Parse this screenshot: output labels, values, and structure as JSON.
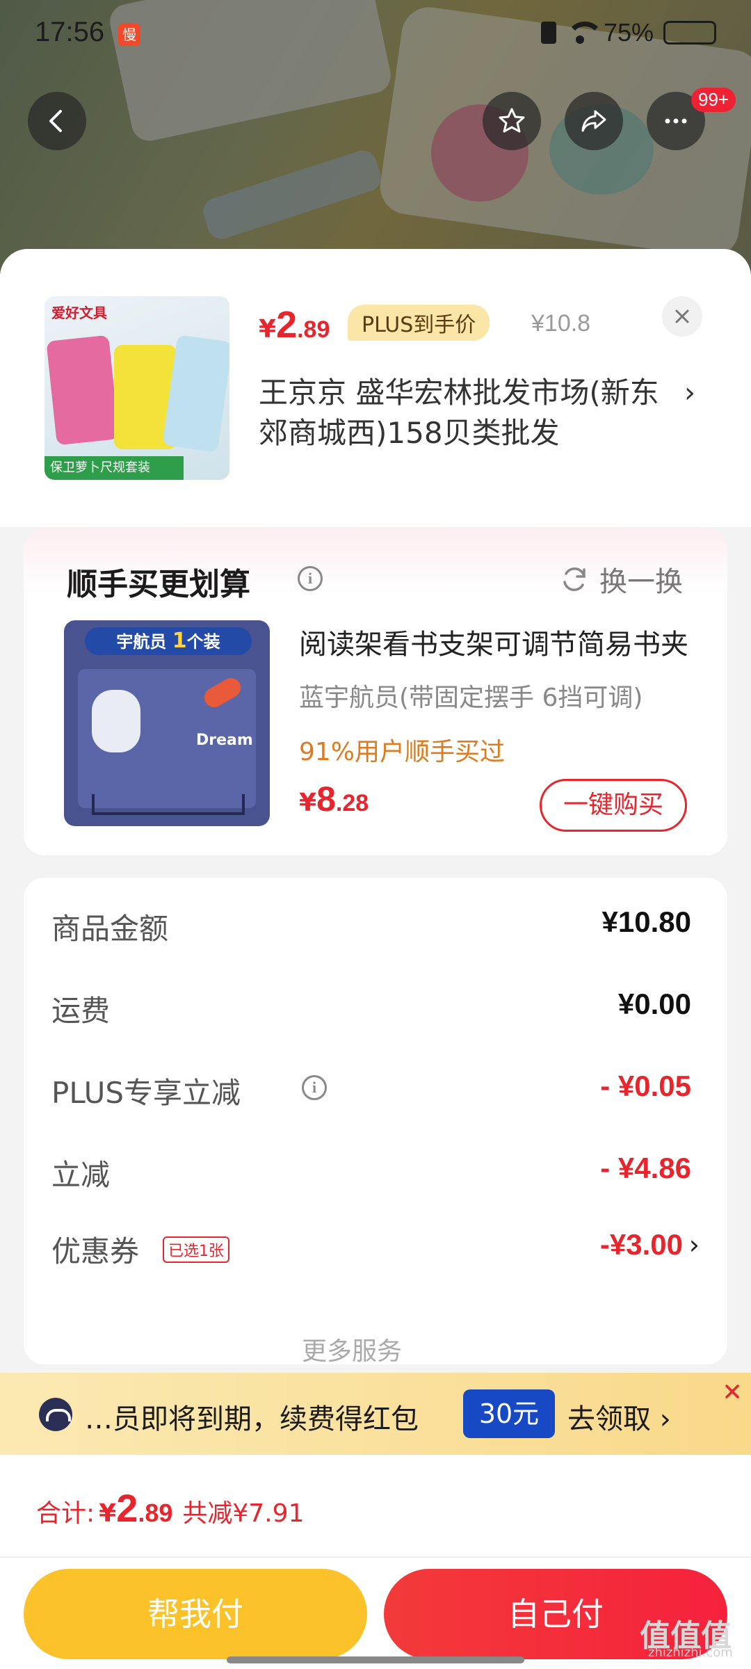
{
  "status_bar": {
    "time": "17:56",
    "badge": "慢",
    "battery": "75%",
    "battery_level": 0.75
  },
  "nav": {
    "more_badge": "99+"
  },
  "product": {
    "price_currency": "¥",
    "price_int": "2",
    "price_dec": ".89",
    "plus_tag": "PLUS到手价",
    "original_price": "¥10.8",
    "shop_name": "王京京  盛华宏林批发市场(新东郊商城西)158贝类批发",
    "thumb_brand": "爱好文具",
    "thumb_ribbon": "保卫萝卜尺规套装"
  },
  "recommend": {
    "title": "顺手买更划算",
    "refresh_label": "换一换",
    "item_name": "阅读架看书支架可调节简易书夹",
    "item_spec": "蓝宇航员(带固定摆手 6挡可调)",
    "item_promo": "91%用户顺手买过",
    "price_currency": "¥",
    "price_int": "8",
    "price_dec": ".28",
    "buy_button": "一键购买",
    "img_banner_prefix": "宇航员",
    "img_banner_num": "1",
    "img_banner_suffix": "个装",
    "img_dream": "Dream"
  },
  "summary": {
    "rows": [
      {
        "label": "商品金额",
        "value": "¥10.80"
      },
      {
        "label": "运费",
        "value": "¥0.00"
      },
      {
        "label": "PLUS专享立减",
        "value": "- ¥0.05"
      },
      {
        "label": "立减",
        "value": "- ¥4.86"
      },
      {
        "label": "优惠券",
        "value": "-¥3.00",
        "tag": "已选1张"
      }
    ],
    "cut_text": "更多服务"
  },
  "member_banner": {
    "text": "…员即将到期，续费得红包",
    "amount": "30元",
    "cta": "去领取 ›"
  },
  "bottom": {
    "total_label": "合计:",
    "total_currency": "¥",
    "total_int": "2",
    "total_dec": ".89",
    "total_save": "共减¥7.91",
    "help_pay": "帮我付",
    "self_pay": "自己付",
    "watermark": "值值值",
    "watermark_sub": "zhizhizhi.com"
  },
  "colors": {
    "accent_red": "#e8242c",
    "help_yellow": "#fbc22a",
    "promo_orange": "#e07a1f"
  }
}
